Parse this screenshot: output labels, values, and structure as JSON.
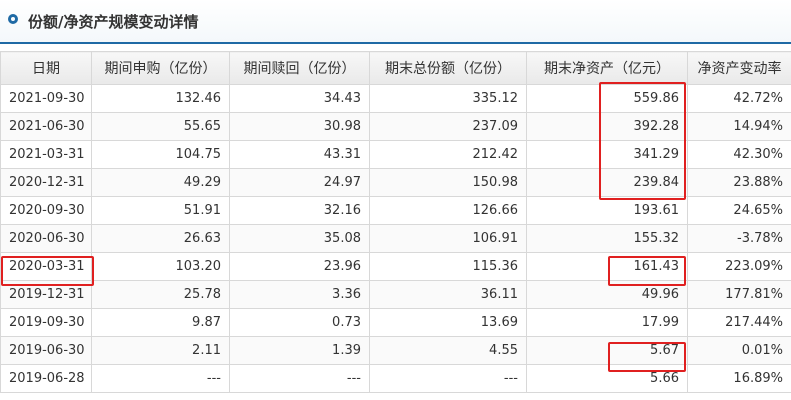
{
  "header": {
    "title": "份额/净资产规模变动详情",
    "icon": "circle-bullet-icon",
    "accent_color": "#1f6aa5"
  },
  "table": {
    "columns": [
      "日期",
      "期间申购（亿份）",
      "期间赎回（亿份）",
      "期末总份额（亿份）",
      "期末净资产（亿元）",
      "净资产变动率"
    ],
    "rows": [
      [
        "2021-09-30",
        "132.46",
        "34.43",
        "335.12",
        "559.86",
        "42.72%"
      ],
      [
        "2021-06-30",
        "55.65",
        "30.98",
        "237.09",
        "392.28",
        "14.94%"
      ],
      [
        "2021-03-31",
        "104.75",
        "43.31",
        "212.42",
        "341.29",
        "42.30%"
      ],
      [
        "2020-12-31",
        "49.29",
        "24.97",
        "150.98",
        "239.84",
        "23.88%"
      ],
      [
        "2020-09-30",
        "51.91",
        "32.16",
        "126.66",
        "193.61",
        "24.65%"
      ],
      [
        "2020-06-30",
        "26.63",
        "35.08",
        "106.91",
        "155.32",
        "-3.78%"
      ],
      [
        "2020-03-31",
        "103.20",
        "23.96",
        "115.36",
        "161.43",
        "223.09%"
      ],
      [
        "2019-12-31",
        "25.78",
        "3.36",
        "36.11",
        "49.96",
        "177.81%"
      ],
      [
        "2019-09-30",
        "9.87",
        "0.73",
        "13.69",
        "17.99",
        "217.44%"
      ],
      [
        "2019-06-30",
        "2.11",
        "1.39",
        "4.55",
        "5.67",
        "0.01%"
      ],
      [
        "2019-06-28",
        "---",
        "---",
        "---",
        "5.66",
        "16.89%"
      ]
    ]
  },
  "highlight_color": "#e02020"
}
